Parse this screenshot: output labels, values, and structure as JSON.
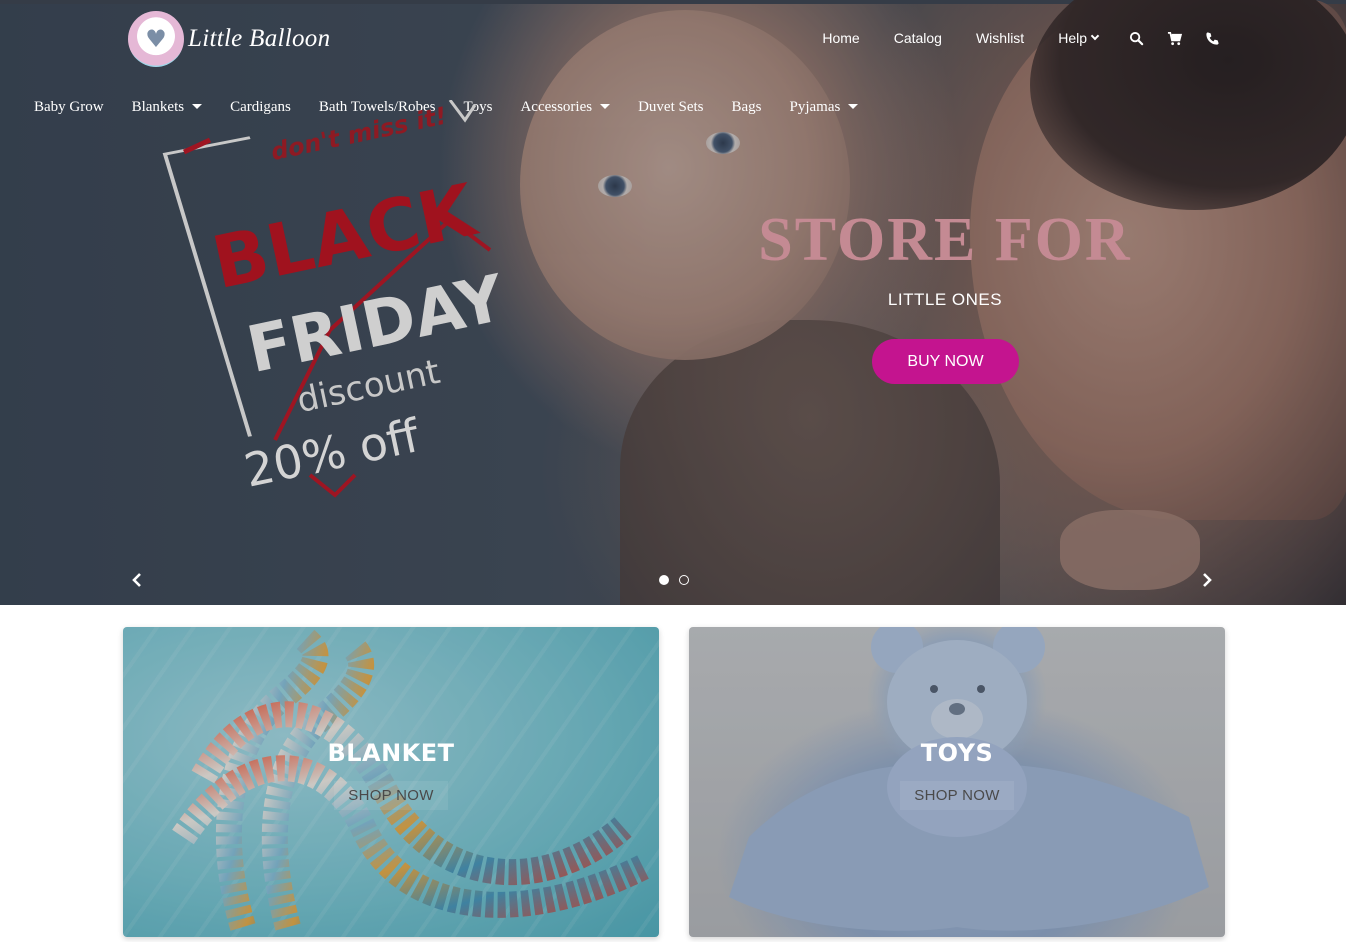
{
  "brand": {
    "name": "Little Balloon"
  },
  "top_nav": {
    "links": [
      "Home",
      "Catalog",
      "Wishlist",
      "Help"
    ],
    "icons": [
      "search-icon",
      "cart-icon",
      "phone-icon"
    ]
  },
  "category_nav": {
    "items": [
      {
        "label": "Baby Grow",
        "dropdown": false
      },
      {
        "label": "Blankets",
        "dropdown": true
      },
      {
        "label": "Cardigans",
        "dropdown": false
      },
      {
        "label": "Bath Towels/Robes",
        "dropdown": false
      },
      {
        "label": "Toys",
        "dropdown": false
      },
      {
        "label": "Accessories",
        "dropdown": true
      },
      {
        "label": "Duvet Sets",
        "dropdown": false
      },
      {
        "label": "Bags",
        "dropdown": false
      },
      {
        "label": "Pyjamas",
        "dropdown": true
      }
    ]
  },
  "promo": {
    "tagline": "don't miss it!",
    "line1": "BLACK",
    "line2": "FRIDAY",
    "line3": "discount",
    "line4": "20% off"
  },
  "hero": {
    "title": "STORE FOR",
    "subtitle": "LITTLE ONES",
    "cta": "BUY NOW",
    "slides_total": 2,
    "active_slide": 1
  },
  "cards": [
    {
      "title": "BLANKET",
      "cta": "SHOP NOW"
    },
    {
      "title": "TOYS",
      "cta": "SHOP NOW"
    }
  ],
  "colors": {
    "accent": "#c4148f",
    "hero_title": "#c48a93",
    "promo_red": "#9e1522"
  }
}
